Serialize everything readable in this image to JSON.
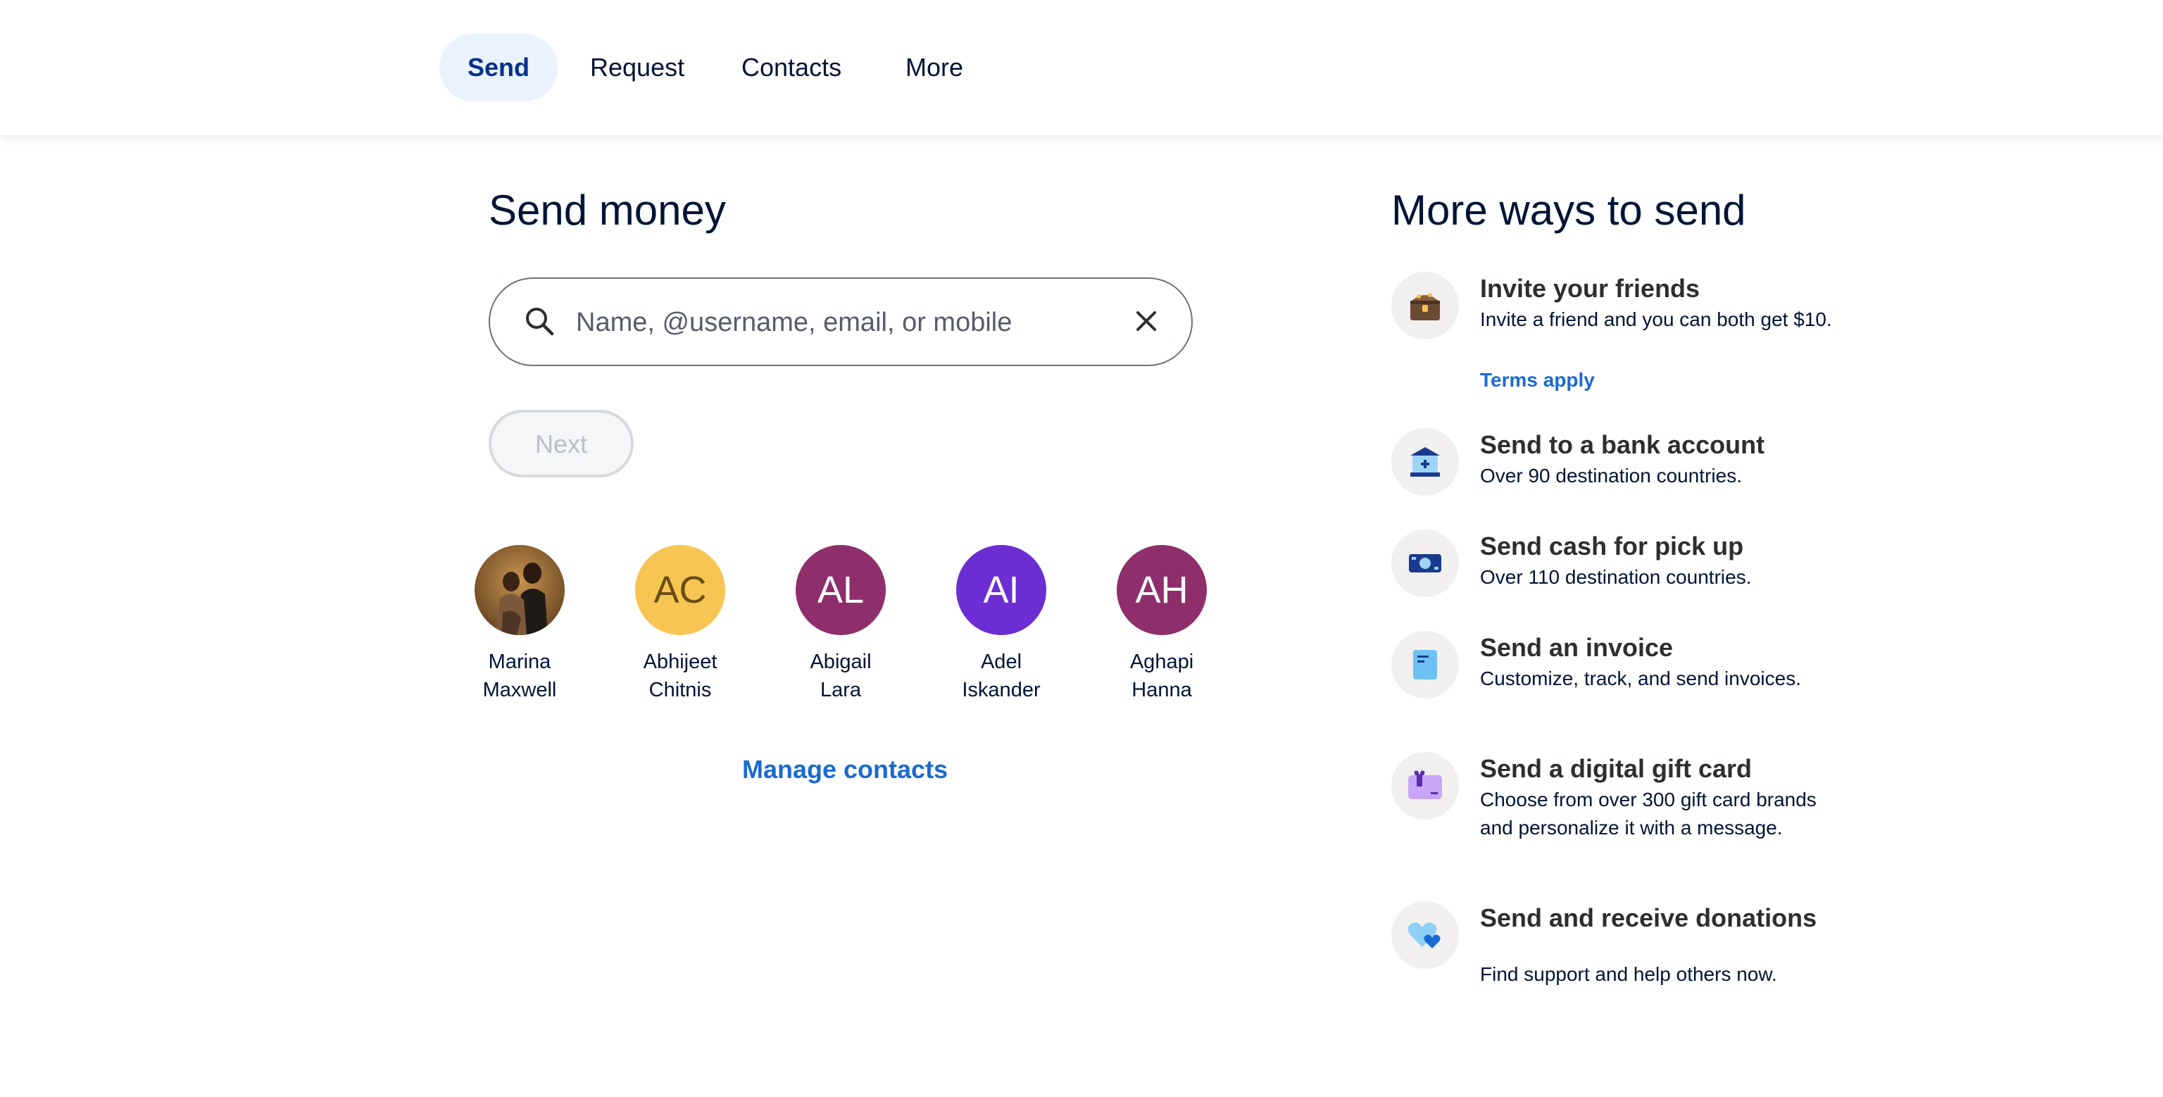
{
  "nav": {
    "tabs": [
      "Send",
      "Request",
      "Contacts",
      "More"
    ],
    "active": "Send"
  },
  "send": {
    "title": "Send money",
    "search_placeholder": "Name, @username, email, or mobile",
    "search_value": "",
    "next_label": "Next",
    "manage_label": "Manage contacts"
  },
  "contacts": [
    {
      "first": "Marina",
      "last": "Maxwell",
      "initials": "",
      "color": "#6b4a2e",
      "photo": true
    },
    {
      "first": "Abhijeet",
      "last": "Chitnis",
      "initials": "AC",
      "color": "#f7c553",
      "text_color": "#6b4d10"
    },
    {
      "first": "Abigail",
      "last": "Lara",
      "initials": "AL",
      "color": "#8e2e6c"
    },
    {
      "first": "Adel",
      "last": "Iskander",
      "initials": "AI",
      "color": "#6c2dd2"
    },
    {
      "first": "Aghapi",
      "last": "Hanna",
      "initials": "AH",
      "color": "#8e2e6c"
    }
  ],
  "more": {
    "title": "More ways to send",
    "items": [
      {
        "title": "Invite your friends",
        "desc": "Invite a friend and you can both get $10.",
        "link": "Terms apply",
        "icon": "treasure-chest-icon"
      },
      {
        "title": "Send to a bank account",
        "desc": "Over 90 destination countries.",
        "icon": "bank-icon"
      },
      {
        "title": "Send cash for pick up",
        "desc": "Over 110 destination countries.",
        "icon": "cash-icon"
      },
      {
        "title": "Send an invoice",
        "desc": "Customize, track, and send invoices.",
        "icon": "invoice-icon"
      },
      {
        "title": "Send a digital gift card",
        "desc": "Choose from over 300 gift card brands and personalize it with a message.",
        "icon": "gift-card-icon"
      },
      {
        "title": "Send and receive donations",
        "desc": "Find support and help others now.",
        "icon": "hearts-icon"
      }
    ]
  },
  "colors": {
    "accent": "#1a6ad2",
    "brand_dark": "#003087",
    "active_tab_bg": "#eaf3fd"
  }
}
